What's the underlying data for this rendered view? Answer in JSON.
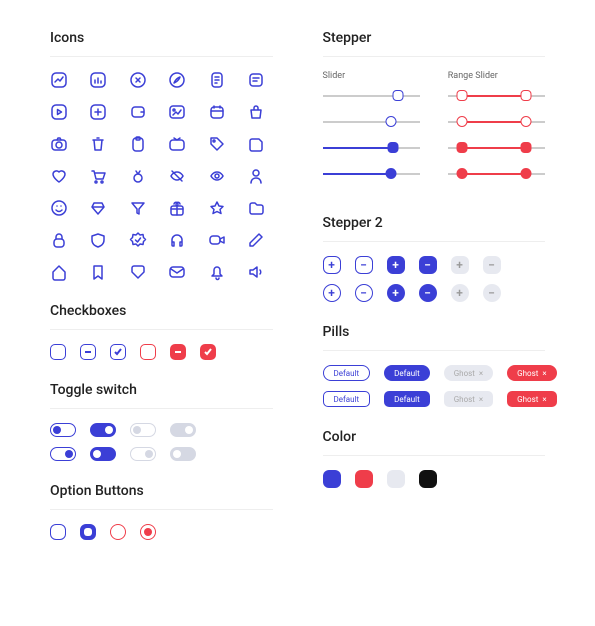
{
  "sections": {
    "icons": "Icons",
    "checkboxes": "Checkboxes",
    "toggle": "Toggle switch",
    "option": "Option Buttons",
    "stepper": "Stepper",
    "slider": "Slider",
    "range_slider": "Range Slider",
    "stepper2": "Stepper 2",
    "pills": "Pills",
    "color": "Color"
  },
  "pills": {
    "default": "Default",
    "ghost": "Ghost"
  },
  "colors": {
    "blue": "#3b3fd6",
    "red": "#ef3d4a",
    "grey": "#e7e9f0",
    "black": "#101010"
  }
}
